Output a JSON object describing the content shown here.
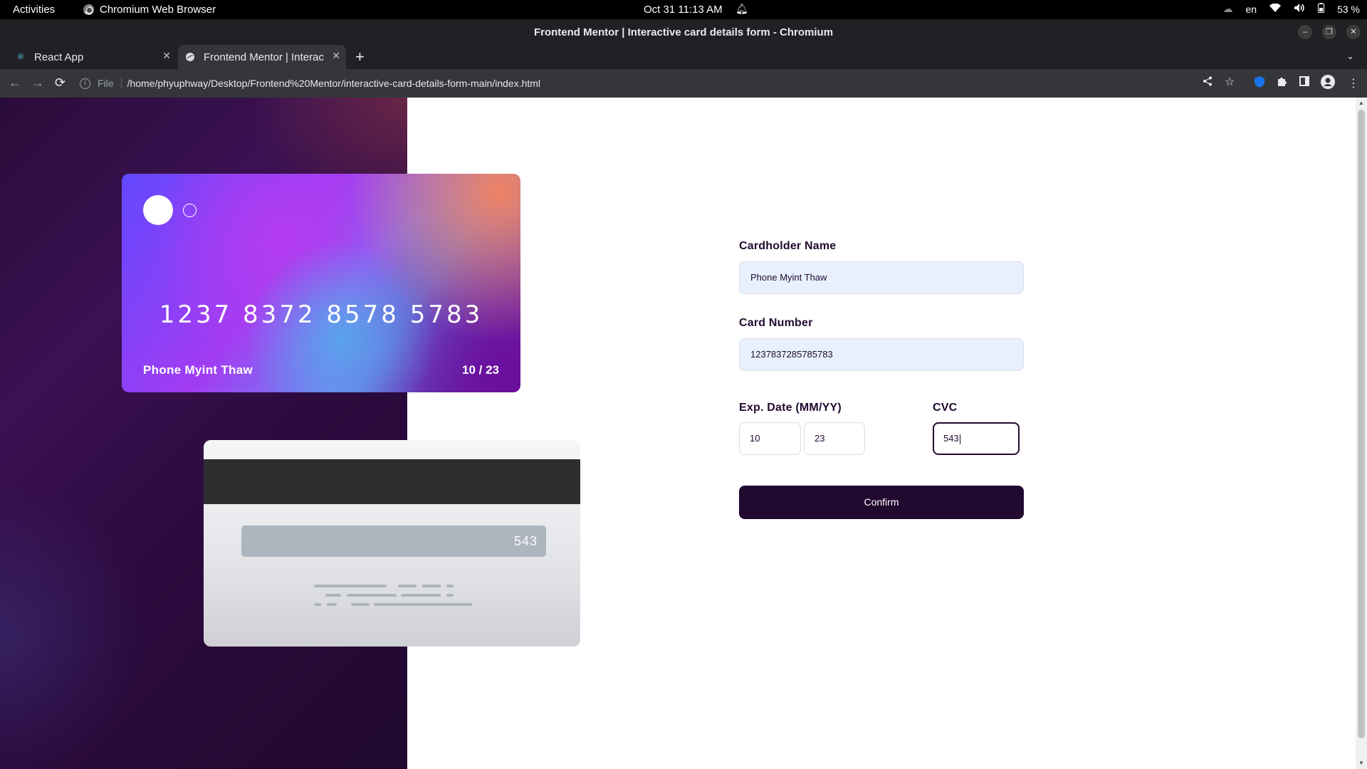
{
  "system": {
    "activities": "Activities",
    "app_name": "Chromium Web Browser",
    "clock": "Oct 31  11:13 AM",
    "language": "en",
    "battery": "53 %"
  },
  "window": {
    "title": "Frontend Mentor | Interactive card details form - Chromium"
  },
  "tabs": [
    {
      "label": "React App",
      "icon": "react-icon"
    },
    {
      "label": "Frontend Mentor | Interac",
      "icon": "globe-icon"
    }
  ],
  "address_bar": {
    "scheme": "File",
    "url": "/home/phyuphway/Desktop/Frontend%20Mentor/interactive-card-details-form-main/index.html"
  },
  "card_front": {
    "number": "1237 8372 8578 5783",
    "holder": "Phone Myint Thaw",
    "expiry": "10 / 23"
  },
  "card_back": {
    "cvc": "543"
  },
  "form": {
    "name_label": "Cardholder Name",
    "name_value": "Phone Myint Thaw",
    "number_label": "Card Number",
    "number_value": "1237837285785783",
    "exp_label": "Exp. Date (MM/YY)",
    "exp_month": "10",
    "exp_year": "23",
    "cvc_label": "CVC",
    "cvc_value": "543",
    "confirm_label": "Confirm"
  },
  "colors": {
    "dark_violet": "#21092f",
    "field_autofill": "#e8f0fe",
    "browser_dark": "#202124",
    "toolbar": "#35363a"
  }
}
